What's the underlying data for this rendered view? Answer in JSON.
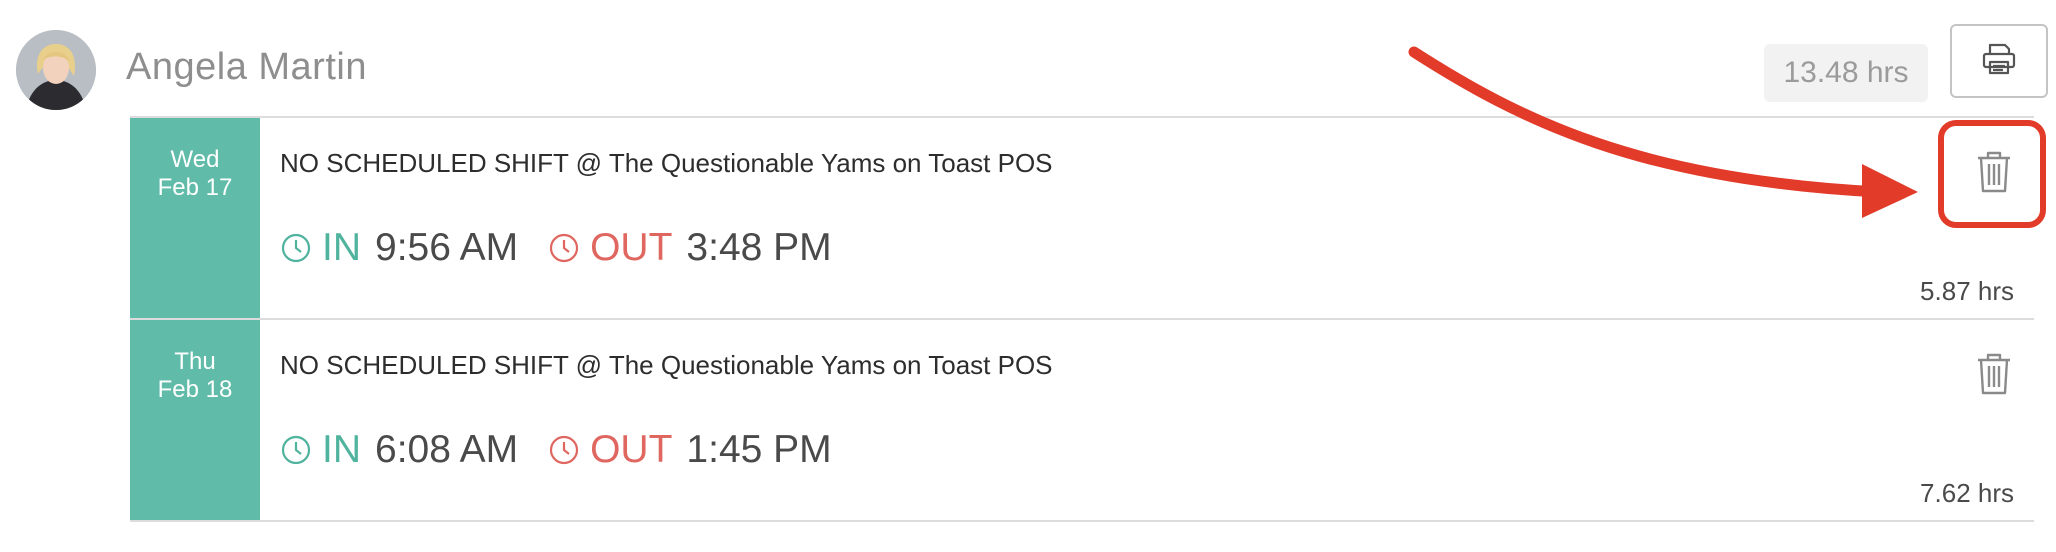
{
  "employee": {
    "name": "Angela Martin",
    "total_hours": "13.48 hrs"
  },
  "toolbar": {
    "print_icon": "printer-icon"
  },
  "shifts": [
    {
      "day": "Wed",
      "date": "Feb 17",
      "title": "NO SCHEDULED SHIFT @ The Questionable Yams on Toast POS",
      "in_label": "IN",
      "in_time": "9:56 AM",
      "out_label": "OUT",
      "out_time": "3:48 PM",
      "hours": "5.87 hrs",
      "delete_icon": "trash-icon"
    },
    {
      "day": "Thu",
      "date": "Feb 18",
      "title": "NO SCHEDULED SHIFT @ The Questionable Yams on Toast POS",
      "in_label": "IN",
      "in_time": "6:08 AM",
      "out_label": "OUT",
      "out_time": "1:45 PM",
      "hours": "7.62 hrs",
      "delete_icon": "trash-icon"
    }
  ],
  "colors": {
    "date_cell": "#60bba9",
    "in": "#4fb39e",
    "out": "#e06660",
    "annotation": "#e23b2a"
  }
}
